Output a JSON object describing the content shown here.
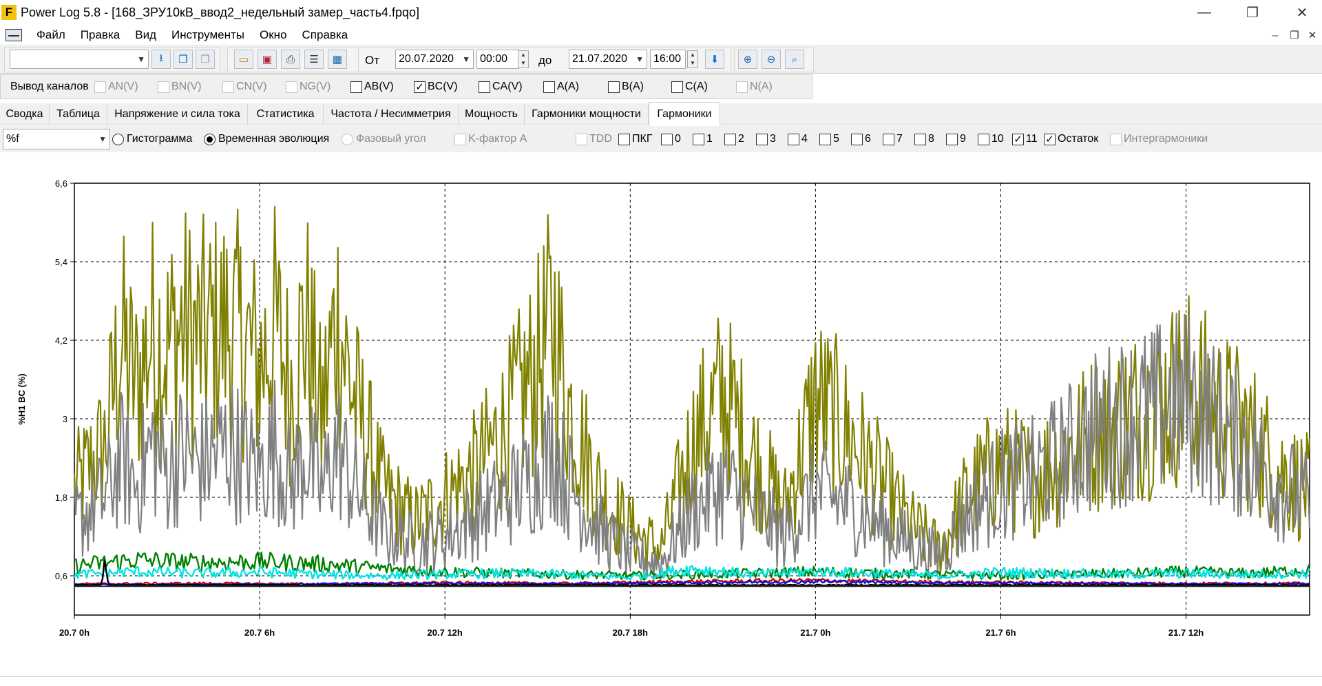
{
  "window": {
    "title": "Power Log 5.8 - [168_ЗРУ10кВ_ввод2_недельный замер_часть4.fpqo]",
    "logo": "F",
    "controls": {
      "minimize": "—",
      "maximize": "❐",
      "close": "✕"
    }
  },
  "menu": {
    "items": [
      "Файл",
      "Правка",
      "Вид",
      "Инструменты",
      "Окно",
      "Справка"
    ],
    "mdi_controls": {
      "minimize": "–",
      "restore": "❐",
      "close": "✕"
    }
  },
  "toolbar": {
    "profile_select": "",
    "from_label": "От",
    "from_date": "20.07.2020",
    "from_time": "00:00",
    "to_label": "до",
    "to_date": "21.07.2020",
    "to_time": "16:00",
    "icons": [
      "download-icon",
      "copy-icon",
      "copy-disabled-icon",
      "open-folder-icon",
      "save-icon",
      "print-icon",
      "export-icon",
      "table-icon",
      "apply-icon",
      "zoom-in-icon",
      "zoom-out-icon",
      "zoom-fit-icon"
    ]
  },
  "channels": {
    "label": "Вывод каналов",
    "items": [
      {
        "label": "AN(V)",
        "checked": false,
        "enabled": false
      },
      {
        "label": "BN(V)",
        "checked": false,
        "enabled": false
      },
      {
        "label": "CN(V)",
        "checked": false,
        "enabled": false
      },
      {
        "label": "NG(V)",
        "checked": false,
        "enabled": false
      },
      {
        "label": "AB(V)",
        "checked": false,
        "enabled": true
      },
      {
        "label": "BC(V)",
        "checked": true,
        "enabled": true
      },
      {
        "label": "CA(V)",
        "checked": false,
        "enabled": true
      },
      {
        "label": "A(A)",
        "checked": false,
        "enabled": true
      },
      {
        "label": "B(A)",
        "checked": false,
        "enabled": true
      },
      {
        "label": "C(A)",
        "checked": false,
        "enabled": true
      },
      {
        "label": "N(A)",
        "checked": false,
        "enabled": false
      }
    ]
  },
  "tabs": {
    "items": [
      "Сводка",
      "Таблица",
      "Напряжение и сила тока",
      "Статистика",
      "Частота / Несимметрия",
      "Мощность",
      "Гармоники мощности",
      "Гармоники"
    ],
    "active": "Гармоники"
  },
  "options": {
    "unit_select": "%f",
    "radios": [
      {
        "label": "Гистограмма",
        "selected": false,
        "enabled": true
      },
      {
        "label": "Временная эволюция",
        "selected": true,
        "enabled": true
      },
      {
        "label": "Фазовый угол",
        "selected": false,
        "enabled": false
      }
    ],
    "checks": [
      {
        "label": "K-фактор A",
        "checked": false,
        "enabled": false
      },
      {
        "label": "TDD",
        "checked": false,
        "enabled": false
      },
      {
        "label": "ПКГ",
        "checked": false,
        "enabled": true
      },
      {
        "label": "0",
        "checked": false,
        "enabled": true
      },
      {
        "label": "1",
        "checked": false,
        "enabled": true
      },
      {
        "label": "2",
        "checked": false,
        "enabled": true
      },
      {
        "label": "3",
        "checked": false,
        "enabled": true
      },
      {
        "label": "4",
        "checked": false,
        "enabled": true
      },
      {
        "label": "5",
        "checked": false,
        "enabled": true
      },
      {
        "label": "6",
        "checked": false,
        "enabled": true
      },
      {
        "label": "7",
        "checked": false,
        "enabled": true
      },
      {
        "label": "8",
        "checked": false,
        "enabled": true
      },
      {
        "label": "9",
        "checked": false,
        "enabled": true
      },
      {
        "label": "10",
        "checked": false,
        "enabled": true
      },
      {
        "label": "11",
        "checked": true,
        "enabled": true
      },
      {
        "label": "Остаток",
        "checked": true,
        "enabled": true
      },
      {
        "label": "Интергармоники",
        "checked": false,
        "enabled": false
      }
    ]
  },
  "chart_data": {
    "type": "line",
    "ylabel": "%H1 BC (%)",
    "ylim": [
      0,
      6.6
    ],
    "yticks": [
      "6,6",
      "5,4",
      "4,2",
      "3",
      "1,8",
      "0,6"
    ],
    "ytick_values": [
      6.6,
      5.4,
      4.2,
      3.0,
      1.8,
      0.6
    ],
    "xlim_hours": [
      0,
      40
    ],
    "xticks": [
      "20.7 0h",
      "20.7 6h",
      "20.7 12h",
      "20.7 18h",
      "21.7 0h",
      "21.7 6h",
      "21.7 12h"
    ],
    "xtick_hours": [
      0,
      6,
      12,
      18,
      24,
      30,
      36
    ],
    "grid": true,
    "series": [
      {
        "color": "#808000",
        "x_hours": [
          0,
          1,
          1.5,
          2,
          2.5,
          3,
          3.5,
          4,
          5,
          5.5,
          6,
          6.5,
          7,
          7.5,
          8,
          8.5,
          9,
          10,
          11,
          12,
          13,
          14,
          15,
          15.5,
          16,
          17,
          18,
          19,
          20,
          21,
          22,
          23,
          24,
          25,
          26,
          27,
          28,
          29,
          30,
          31,
          32,
          33,
          34,
          35,
          36,
          37,
          38,
          39,
          40
        ],
        "values": [
          1.9,
          2.6,
          4.2,
          3.5,
          4.3,
          4.1,
          4.4,
          4.2,
          4.4,
          4.2,
          3.8,
          4.4,
          3.5,
          4.5,
          3.0,
          4.6,
          3.4,
          1.9,
          1.4,
          1.8,
          2.2,
          2.9,
          3.8,
          4.5,
          3.2,
          1.9,
          1.3,
          1.0,
          2.6,
          3.4,
          2.4,
          1.6,
          3.3,
          2.8,
          2.1,
          1.4,
          1.0,
          1.9,
          2.3,
          2.1,
          2.4,
          2.8,
          3.0,
          3.2,
          3.5,
          3.1,
          2.8,
          2.2,
          1.9
        ]
      },
      {
        "color": "#808080",
        "x_hours": [
          0,
          1,
          1.5,
          2,
          2.5,
          3,
          3.5,
          4,
          5,
          5.5,
          6,
          6.5,
          7,
          7.5,
          8,
          8.5,
          9,
          10,
          11,
          12,
          13,
          14,
          15,
          15.5,
          16,
          17,
          18,
          19,
          20,
          21,
          22,
          23,
          24,
          25,
          26,
          27,
          28,
          29,
          30,
          31,
          32,
          33,
          34,
          35,
          36,
          37,
          38,
          39,
          40
        ],
        "values": [
          1.4,
          1.8,
          2.4,
          2.0,
          2.6,
          2.2,
          2.5,
          2.3,
          2.6,
          2.4,
          2.2,
          2.6,
          2.0,
          2.5,
          1.9,
          2.6,
          2.0,
          1.3,
          1.1,
          1.2,
          1.5,
          1.8,
          2.2,
          2.6,
          2.0,
          1.3,
          0.9,
          0.8,
          1.6,
          2.0,
          1.6,
          1.2,
          1.9,
          1.7,
          1.4,
          1.1,
          0.9,
          1.6,
          2.0,
          2.1,
          2.4,
          2.8,
          3.0,
          3.1,
          3.3,
          2.9,
          2.5,
          2.0,
          1.7
        ]
      },
      {
        "color": "#008000",
        "x_hours": [
          0,
          2,
          4,
          6,
          8,
          10,
          12,
          14,
          16,
          18,
          20,
          22,
          24,
          26,
          28,
          30,
          32,
          34,
          36,
          38,
          40
        ],
        "values": [
          0.35,
          0.45,
          0.4,
          0.42,
          0.38,
          0.3,
          0.25,
          0.22,
          0.2,
          0.18,
          0.2,
          0.22,
          0.25,
          0.22,
          0.2,
          0.18,
          0.2,
          0.22,
          0.25,
          0.22,
          0.28
        ]
      },
      {
        "color": "#00e5e5",
        "x_hours": [
          0,
          2,
          4,
          6,
          8,
          10,
          12,
          14,
          16,
          18,
          20,
          22,
          24,
          26,
          28,
          30,
          32,
          34,
          36,
          38,
          40
        ],
        "values": [
          0.2,
          0.25,
          0.22,
          0.24,
          0.2,
          0.18,
          0.2,
          0.22,
          0.2,
          0.15,
          0.3,
          0.2,
          0.25,
          0.22,
          0.18,
          0.24,
          0.22,
          0.2,
          0.22,
          0.2,
          0.22
        ]
      },
      {
        "color": "#d00000",
        "x_hours": [
          0,
          4,
          8,
          12,
          16,
          20,
          24,
          28,
          32,
          36,
          40
        ],
        "values": [
          0.04,
          0.05,
          0.04,
          0.06,
          0.05,
          0.08,
          0.1,
          0.07,
          0.06,
          0.05,
          0.05
        ]
      },
      {
        "color": "#1010d0",
        "x_hours": [
          0,
          4,
          8,
          12,
          16,
          20,
          24,
          28,
          32,
          36,
          40
        ],
        "values": [
          0.03,
          0.03,
          0.04,
          0.05,
          0.04,
          0.06,
          0.08,
          0.06,
          0.05,
          0.04,
          0.04
        ]
      },
      {
        "color": "#000000",
        "x_hours": [
          0,
          0.9,
          1.0,
          1.1,
          2,
          10,
          20,
          30,
          40
        ],
        "values": [
          0.02,
          0.02,
          0.6,
          0.02,
          0.02,
          0.02,
          0.02,
          0.02,
          0.02
        ]
      }
    ]
  },
  "colors": {
    "grid": "#000000",
    "frame": "#000000",
    "tab_active_bg": "#ffffff",
    "bar_bg": "#f0f0f0"
  }
}
